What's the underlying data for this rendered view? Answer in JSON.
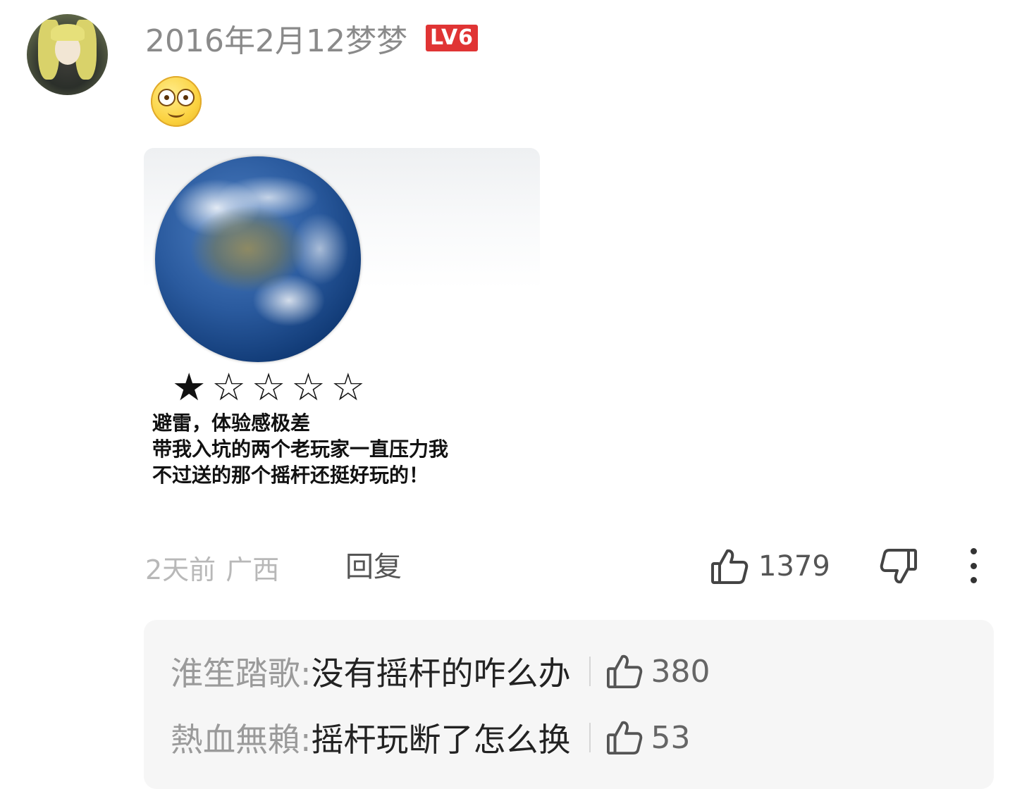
{
  "comment": {
    "date": "2016年2月12",
    "username": "梦梦",
    "level_badge": "LV6",
    "emoji_icon": "flushed-smile-emoji",
    "image": {
      "stars": "★☆☆☆☆",
      "rating_filled": 1,
      "rating_max": 5,
      "lines": [
        "避雷，体验感极差",
        "带我入坑的两个老玩家一直压力我",
        "不过送的那个摇杆还挺好玩的！"
      ]
    },
    "time": "2天前",
    "location": "广西",
    "reply_label": "回复",
    "likes": "1379"
  },
  "replies": [
    {
      "user": "淮笙踏歌:",
      "text": " 没有摇杆的咋么办",
      "likes": "380"
    },
    {
      "user": "熱血無賴:",
      "text": " 摇杆玩断了怎么换",
      "likes": "53"
    }
  ],
  "colors": {
    "badge": "#e03434",
    "muted_text": "#8a8a8a",
    "reply_bg": "#f6f6f6"
  }
}
